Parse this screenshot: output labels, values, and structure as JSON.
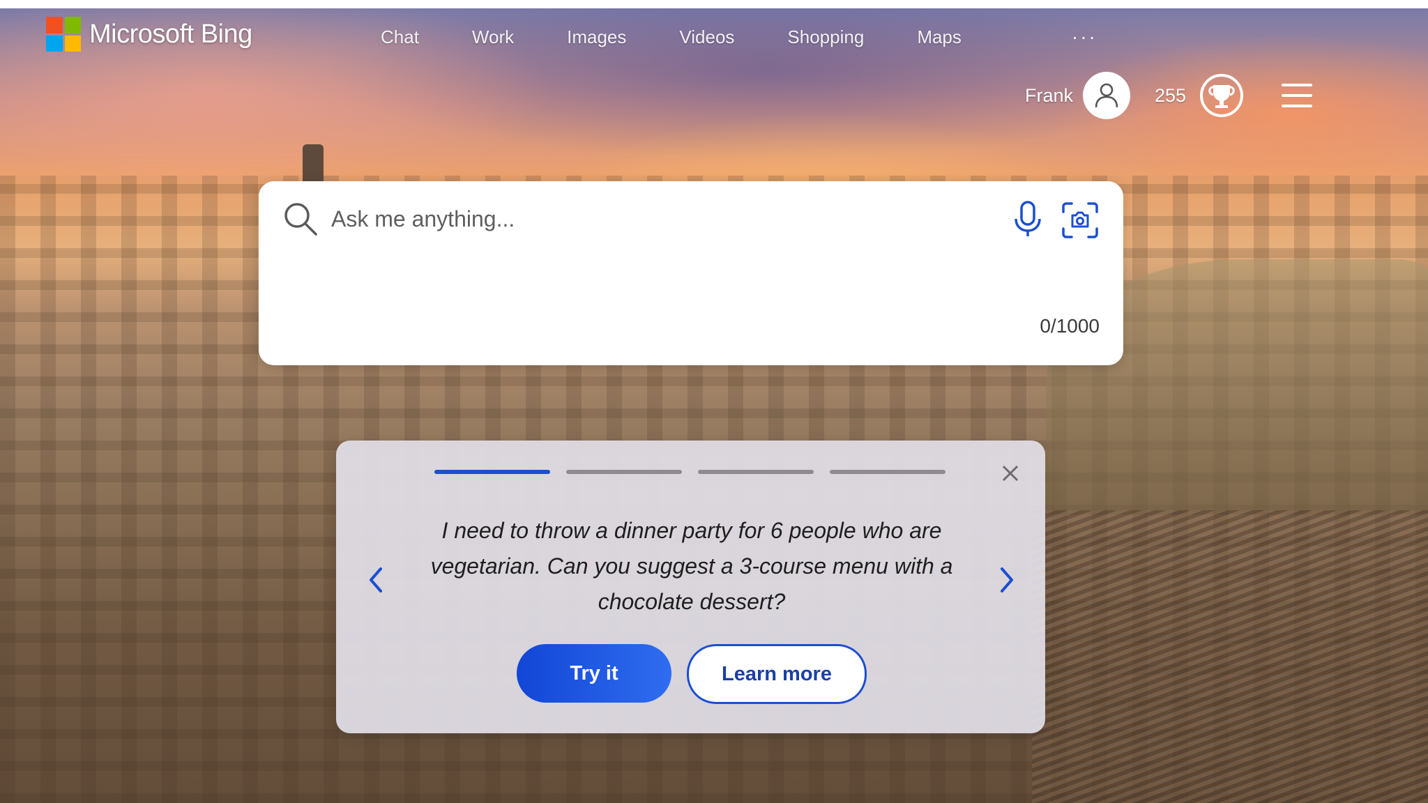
{
  "brand": {
    "name": "Microsoft Bing",
    "logo_colors": [
      "#f25022",
      "#7fba00",
      "#00a4ef",
      "#ffb900"
    ]
  },
  "nav": {
    "items": [
      "Chat",
      "Work",
      "Images",
      "Videos",
      "Shopping",
      "Maps"
    ],
    "more": "···"
  },
  "user": {
    "name": "Frank",
    "points": "255",
    "avatar_icon": "person-icon",
    "reward_icon": "trophy-icon"
  },
  "search": {
    "placeholder": "Ask me anything...",
    "value": "",
    "char_count": "0/1000",
    "mic_icon": "microphone-icon",
    "visual_search_icon": "camera-search-icon"
  },
  "suggestion_card": {
    "prompt": "I need to throw a dinner party for 6 people who are vegetarian. Can you suggest a 3-course menu with a chocolate dessert?",
    "step_current": 1,
    "step_total": 4,
    "try_label": "Try it",
    "learn_label": "Learn more"
  },
  "colors": {
    "accent": "#1b4fd0",
    "card_bg": "#e2e0e8"
  }
}
